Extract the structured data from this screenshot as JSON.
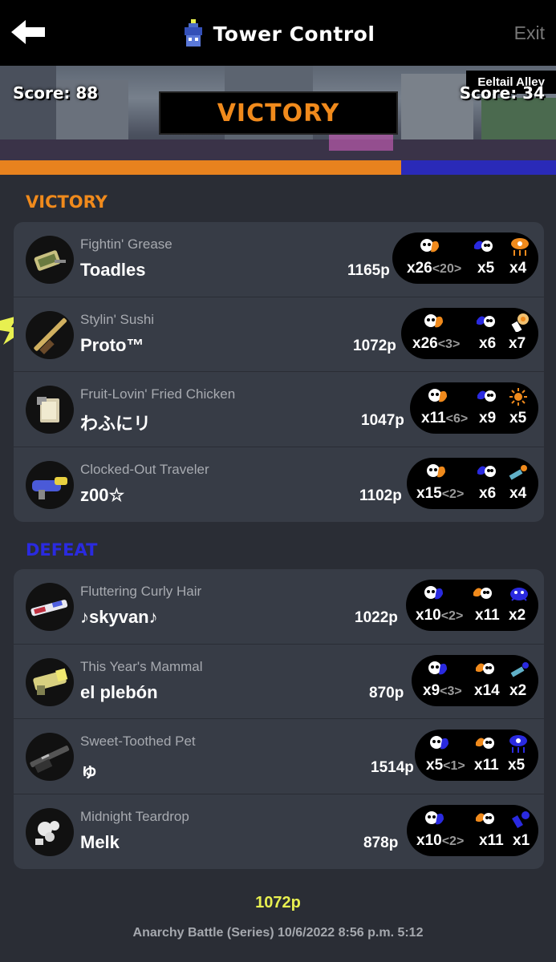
{
  "header": {
    "title": "Tower Control",
    "exit_label": "Exit",
    "back_icon": "back-arrow-icon",
    "mode_icon": "tower-icon"
  },
  "banner": {
    "stage": "Eeltail Alley",
    "result": "VICTORY",
    "score_left": "Score: 88",
    "score_right": "Score: 34",
    "score_left_value": 88,
    "score_right_value": 34
  },
  "colors": {
    "alpha": "#f08a1c",
    "bravo": "#2a2ae0",
    "panel": "#373c46",
    "background": "#2a2d35",
    "highlight": "#e8f050"
  },
  "victory_team": {
    "label": "VICTORY",
    "players": [
      {
        "byname": "Fightin' Grease",
        "name": "Toadles",
        "points": "1165p",
        "kills": "x26",
        "assists": "<20>",
        "deaths": "x5",
        "specials": "x4",
        "weapon_icon": "splat-roller-icon",
        "special_icon": "ink-storm-icon"
      },
      {
        "byname": "Stylin' Sushi",
        "name": "Proto™",
        "points": "1072p",
        "kills": "x26",
        "assists": "<3>",
        "deaths": "x6",
        "specials": "x7",
        "weapon_icon": "splat-charger-icon",
        "special_icon": "tacticooler-icon"
      },
      {
        "byname": "Fruit-Lovin' Fried Chicken",
        "name": "わふにリ",
        "points": "1047p",
        "kills": "x11",
        "assists": "<6>",
        "deaths": "x9",
        "specials": "x5",
        "weapon_icon": "splatana-icon",
        "special_icon": "booyah-bomb-icon"
      },
      {
        "byname": "Clocked-Out Traveler",
        "name": "z00☆",
        "points": "1102p",
        "kills": "x15",
        "assists": "<2>",
        "deaths": "x6",
        "specials": "x4",
        "weapon_icon": "blaster-icon",
        "special_icon": "ink-vac-icon"
      }
    ]
  },
  "defeat_team": {
    "label": "DEFEAT",
    "players": [
      {
        "byname": "Fluttering Curly Hair",
        "name": "♪skyvan♪",
        "points": "1022p",
        "kills": "x10",
        "assists": "<2>",
        "deaths": "x11",
        "specials": "x2",
        "weapon_icon": "shooter-icon",
        "special_icon": "crab-tank-icon"
      },
      {
        "byname": "This Year's Mammal",
        "name": "el plebón",
        "points": "870p",
        "kills": "x9",
        "assists": "<3>",
        "deaths": "x14",
        "specials": "x2",
        "weapon_icon": "splatling-icon",
        "special_icon": "ink-vac-icon"
      },
      {
        "byname": "Sweet-Toothed Pet",
        "name": "ゅ",
        "points": "1514p",
        "kills": "x5",
        "assists": "<1>",
        "deaths": "x11",
        "specials": "x5",
        "weapon_icon": "e-liter-icon",
        "special_icon": "ink-storm-icon"
      },
      {
        "byname": "Midnight Teardrop",
        "name": "Melk",
        "points": "878p",
        "kills": "x10",
        "assists": "<2>",
        "deaths": "x11",
        "specials": "x1",
        "weapon_icon": "dualies-icon",
        "special_icon": "tacticooler-icon"
      }
    ]
  },
  "footer": {
    "my_points": "1072p",
    "summary": "Anarchy Battle (Series) 10/6/2022 8:56 p.m. 5:12"
  }
}
